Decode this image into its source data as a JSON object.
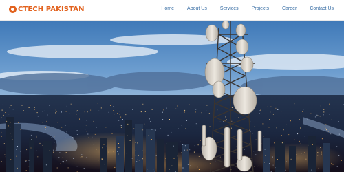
{
  "header": {
    "logo_text": "CTECH PAKISTAN",
    "brand_color": "#e2621e",
    "nav": [
      {
        "label": "Home"
      },
      {
        "label": "About Us"
      },
      {
        "label": "Services"
      },
      {
        "label": "Projects"
      },
      {
        "label": "Career"
      },
      {
        "label": "Contact Us"
      }
    ],
    "nav_color": "#3a6fa5"
  },
  "hero": {
    "image": "telecom-tower-over-city-at-dusk"
  }
}
